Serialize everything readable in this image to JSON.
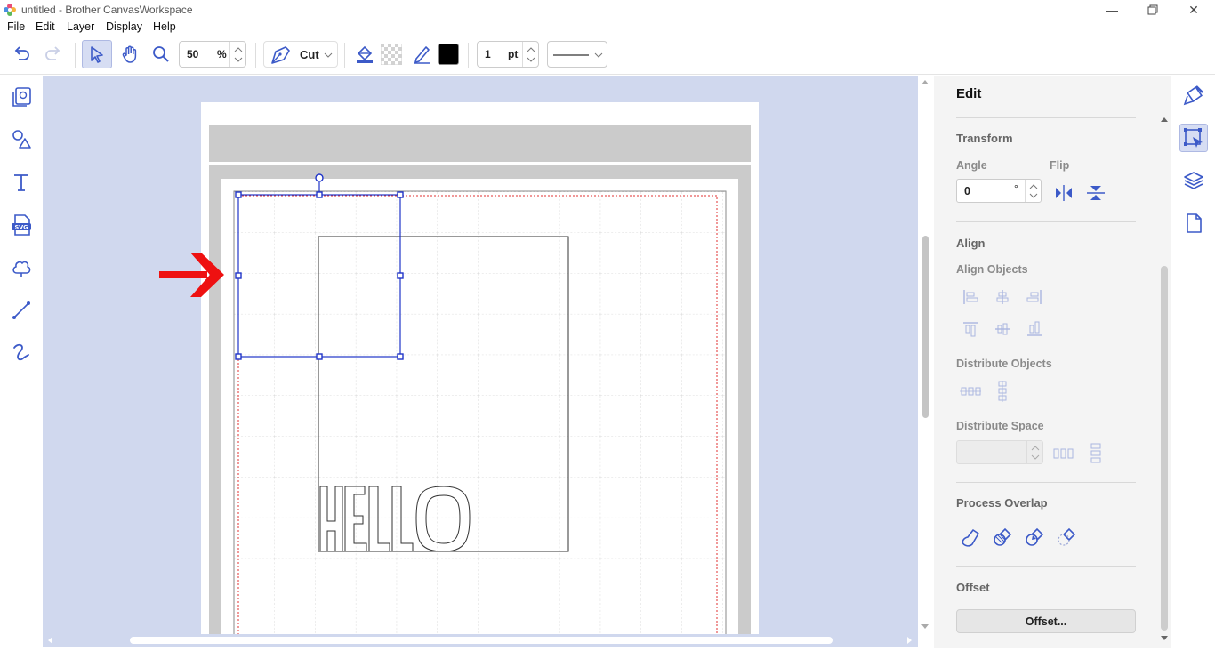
{
  "window": {
    "title": "untitled - Brother CanvasWorkspace",
    "minimize_glyph": "—",
    "close_glyph": "✕"
  },
  "menu": [
    "File",
    "Edit",
    "Layer",
    "Display",
    "Help"
  ],
  "toolbar": {
    "zoom_value": "50",
    "zoom_unit": "%",
    "mode_label": "Cut",
    "line_width_value": "1",
    "line_width_unit": "pt",
    "fill_color": "#000000",
    "accent_color": "#3c5ac8"
  },
  "canvas": {
    "text_object": "HELLO",
    "cut_line_color": "#e03030",
    "selection_color": "#1f34c8",
    "annotation_arrow_color": "#ee1111"
  },
  "panel": {
    "title": "Edit",
    "transform": {
      "heading": "Transform",
      "angle_label": "Angle",
      "angle_value": "0",
      "angle_unit": "°",
      "flip_label": "Flip"
    },
    "align": {
      "heading": "Align",
      "align_objects_label": "Align Objects",
      "distribute_objects_label": "Distribute Objects",
      "distribute_space_label": "Distribute Space"
    },
    "process_overlap": {
      "heading": "Process Overlap"
    },
    "offset": {
      "heading": "Offset",
      "button_label": "Offset..."
    }
  }
}
